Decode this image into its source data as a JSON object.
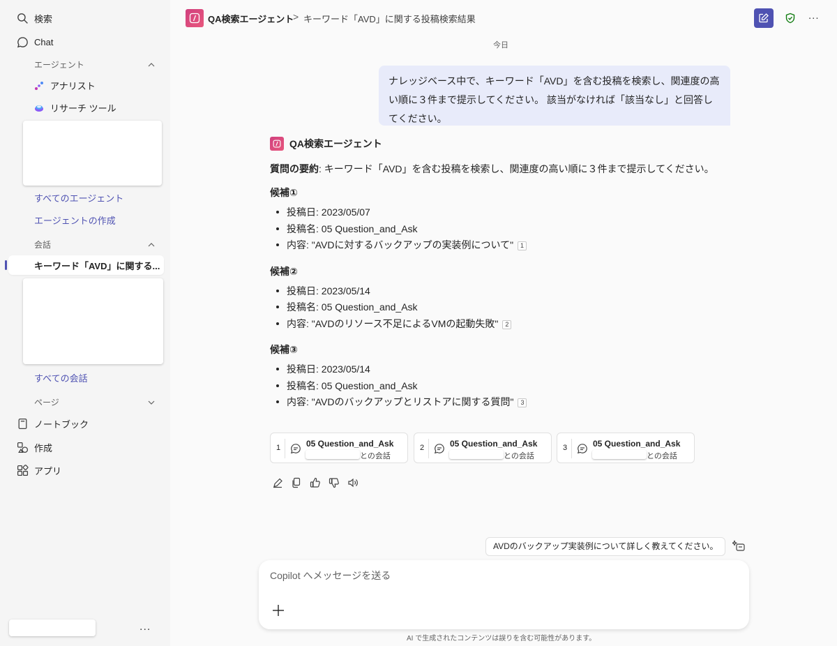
{
  "sidebar": {
    "search_label": "検索",
    "chat_label": "Chat",
    "agents_section": "エージェント",
    "agents": [
      {
        "label": "アナリスト",
        "icon": "analyst-icon"
      },
      {
        "label": "リサーチ ツール",
        "icon": "research-tool-icon"
      }
    ],
    "all_agents_link": "すべてのエージェント",
    "create_agent_link": "エージェントの作成",
    "conversations_section": "会話",
    "active_conversation": "キーワード「AVD」に関する...",
    "all_conversations_link": "すべての会話",
    "pages_section": "ページ",
    "notebook_label": "ノートブック",
    "create_label": "作成",
    "apps_label": "アプリ",
    "more_label": "..."
  },
  "header": {
    "agent_name": "QA検索エージェント",
    "separator": ">",
    "breadcrumb": "キーワード「AVD」に関する投稿検索結果",
    "more_label": "..."
  },
  "chat": {
    "date_label": "今日",
    "user_message": "ナレッジベース中で、キーワード「AVD」を含む投稿を検索し、関連度の高い順に３件まで提示してください。 該当がなければ「該当なし」と回答してください。",
    "response": {
      "agent_name": "QA検索エージェント",
      "summary_label": "質問の要約",
      "summary_text": ": キーワード「AVD」を含む投稿を検索し、関連度の高い順に３件まで提示してください。",
      "candidates": [
        {
          "title": "候補①",
          "date": "投稿日: 2023/05/07",
          "name": "投稿名: 05 Question_and_Ask",
          "content": "内容: \"AVDに対するバックアップの実装例について\"",
          "cite": "1"
        },
        {
          "title": "候補②",
          "date": "投稿日: 2023/05/14",
          "name": "投稿名: 05 Question_and_Ask",
          "content": "内容: \"AVDのリソース不足によるVMの起動失敗\"",
          "cite": "2"
        },
        {
          "title": "候補③",
          "date": "投稿日: 2023/05/14",
          "name": "投稿名: 05 Question_and_Ask",
          "content": "内容: \"AVDのバックアップとリストアに関する質問\"",
          "cite": "3"
        }
      ],
      "references": [
        {
          "num": "1",
          "title": "05 Question_and_Ask",
          "subtitle": "との会話"
        },
        {
          "num": "2",
          "title": "05 Question_and_Ask",
          "subtitle": "との会話"
        },
        {
          "num": "3",
          "title": "05 Question_and_Ask",
          "subtitle": "との会話"
        }
      ]
    },
    "suggestion": "AVDのバックアップ実装例について詳しく教えてください。"
  },
  "composer": {
    "placeholder": "Copilot へメッセージを送る",
    "disclaimer": "AI で生成されたコンテンツは誤りを含む可能性があります。"
  },
  "colors": {
    "accent": "#4f52b2",
    "agent_logo": "#d0407e",
    "user_bubble": "#e8ebfa",
    "shield": "#107c10"
  }
}
